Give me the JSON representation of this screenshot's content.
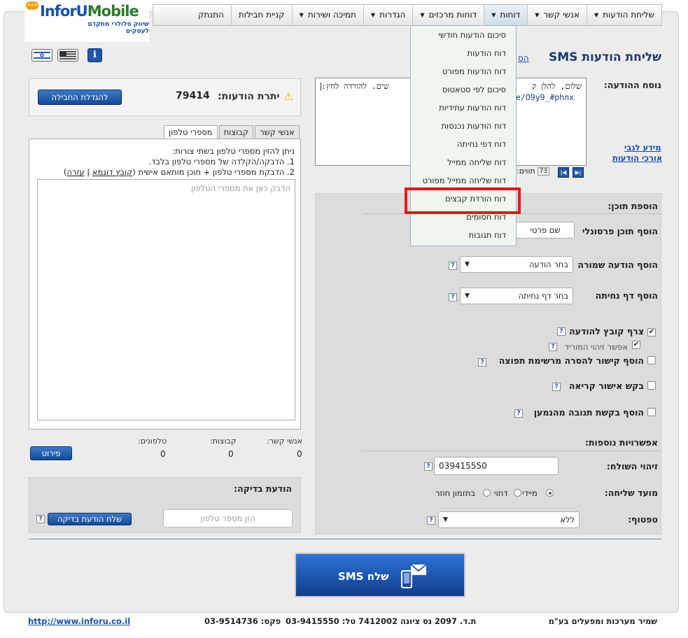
{
  "logo": {
    "brand_a": "InforU",
    "brand_b": "Mobile",
    "tagline": "שיווק סלולרי מתקדם לעסקים"
  },
  "nav": [
    {
      "label": "שליחת הודעות",
      "has_arrow": true
    },
    {
      "label": "אנשי קשר",
      "has_arrow": true
    },
    {
      "label": "דוחות",
      "has_arrow": true
    },
    {
      "label": "דוחות מרכזים",
      "has_arrow": true
    },
    {
      "label": "הגדרות",
      "has_arrow": true
    },
    {
      "label": "תמיכה ושירות",
      "has_arrow": true
    },
    {
      "label": "קניית חבילות",
      "has_arrow": false
    },
    {
      "label": "התנתק",
      "has_arrow": false
    }
  ],
  "reports_menu": [
    "סיכום הודעות חודשי",
    "דוח הודעות",
    "דוח הודעות מפורט",
    "סיכום לפי סטאטוס",
    "דוח הודעות עתידיות",
    "דוח הודעות נכנסות",
    "דוח דפי נחיתה",
    "דוח שליחה ממייל",
    "דוח שליחה ממייל מפורט",
    "דוח הורדת קבצים",
    "דוח חסומים",
    "דוח תגובות"
  ],
  "page_title": "שליחת הודעות SMS",
  "title_link": "הס",
  "credit": {
    "label": "יתרת הודעות:",
    "value": "79414",
    "upgrade_button": "להגדלת החבילה"
  },
  "tabs": [
    "אנשי קשר",
    "קבוצות",
    "מספרי טלפון"
  ],
  "phones": {
    "line1": "ניתן להזין מספרי טלפון בשתי צורות:",
    "line2": "1. הדבקה/הקלדה של מספרי טלפון בלבד.",
    "line3": "2. הדבקת מספרי טלפון + תוכן מותאם אישית",
    "link_example": "קובץ דוגמא",
    "link_help": "עזרה",
    "placeholder": "הדבק כאן את מספרי הטלפון"
  },
  "stats": {
    "contacts_label": "אנשי קשר:",
    "groups_label": "קבוצות:",
    "phones_label": "טלפונים:",
    "contacts": "0",
    "groups": "0",
    "phones": "0",
    "details_button": "פירוט"
  },
  "test": {
    "title": "הודעת בדיקה:",
    "placeholder": "הזן מספר טלפון",
    "button": "שלח הודעת בדיקה"
  },
  "message": {
    "label": "נוסח ההודעה:",
    "line1": "שלום, להלן ק",
    "line1_end": "שים. להורדה לחץ:",
    "line2": "e/O9y9_#phnx",
    "legal_link1": "מידע לגבי",
    "legal_link2": "אורכי הודעות",
    "counter_label": "תווים:",
    "counter_value": "73"
  },
  "content": {
    "title": "הוספת תוכן:",
    "personal_label": "הוסף תוכן פרסונלי",
    "personal_value": "שם פרטי",
    "saved_label": "הוסף הודעה שמורה",
    "saved_value": "בחר הודעה",
    "landing_label": "הוסף דף נחיתה",
    "landing_value": "בחר דף נחיתה",
    "attach_label": "צרף קובץ להודעה",
    "downloader_label": "אפשר זיהוי המוריד",
    "unsubscribe_label": "הוסף קישור להסרה מרשימת תפוצה",
    "read_label": "בקש אישור קריאה",
    "reply_label": "הוסף בקשת תגובה מהנמען"
  },
  "options": {
    "title": "אפשרויות נוספות:",
    "sender_label": "זיהוי השולח:",
    "sender_value": "039415550",
    "timing_label": "מועד שליחה:",
    "timing_now": "מיידי",
    "timing_later": "דחוי",
    "timing_repeat": "בתזמון חוזר",
    "throttle_label": "טפטוף:",
    "throttle_value": "ללא"
  },
  "send_button": "שלח SMS",
  "footer": {
    "company": "שמיר מערכות ומפעלים בע\"מ",
    "address": "ת.ד. 2097 נס ציונה 7412002",
    "phone": "טל: 03-9415550",
    "fax": "פקס: 03-9514736",
    "website": "http://www.inforu.co.il"
  },
  "colors": {
    "highlight": "#e0191c",
    "primary_blue": "#1f57a6",
    "menu_bg": "#f0f6ef"
  }
}
